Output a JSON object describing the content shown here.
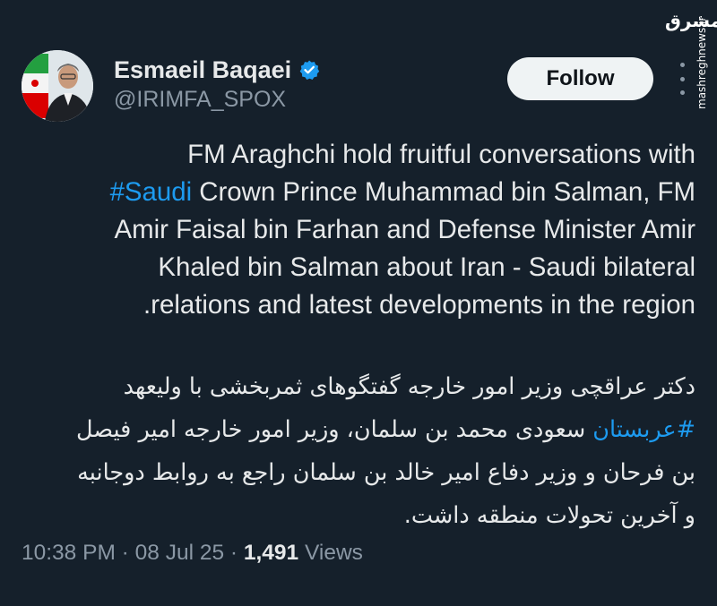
{
  "author": {
    "name": "Esmaeil Baqaei",
    "handle": "@IRIMFA_SPOX",
    "verified_icon": "verified-badge-icon",
    "avatar_icon": "profile-photo-with-iran-flag"
  },
  "follow": {
    "label": "Follow"
  },
  "watermark": {
    "logo_text": "مشرق",
    "site": "mashreghnews.ir"
  },
  "tweet": {
    "en": {
      "line1": "FM Araghchi hold fruitful conversations with",
      "line2_hashtag": "#Saudi",
      "line2_rest": " Crown Prince Muhammad bin Salman, FM",
      "line3": "Amir Faisal bin Farhan and Defense Minister Amir",
      "line4": "Khaled bin Salman about Iran - Saudi bilateral",
      "line5": "relations and latest developments in the region."
    },
    "fa": {
      "line1": "دکتر عراقچی وزیر امور خارجه گفتگوهای ثمربخشی با ولیعهد",
      "line2_hashtag": "#عربستان",
      "line2_rest": " سعودی محمد بن سلمان، وزیر امور خارجه امیر فیصل",
      "line3": "بن فرحان و وزیر دفاع امیر خالد بن سلمان راجع به روابط دوجانبه",
      "line4": "و آخرین تحولات منطقه داشت."
    }
  },
  "meta": {
    "time": "10:38 PM",
    "sep1": " · ",
    "date": "08 Jul 25",
    "sep2": " · ",
    "views_count": "1,491",
    "views_label": " Views"
  },
  "colors": {
    "background": "#15202b",
    "text": "#e7e9ea",
    "secondary": "#8b98a5",
    "accent": "#1d9bf0",
    "follow_bg": "#eff3f4"
  }
}
